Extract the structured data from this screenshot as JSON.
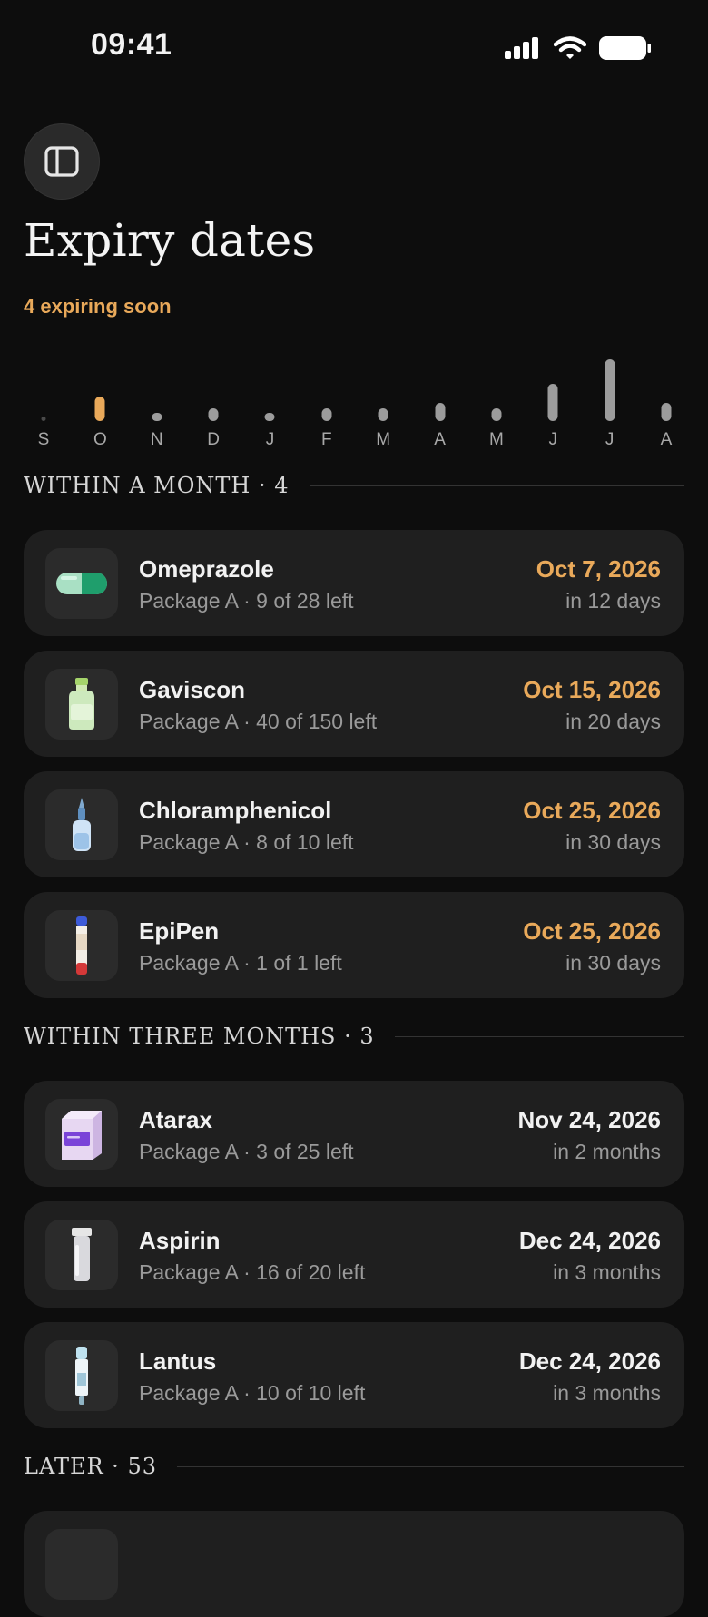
{
  "status_bar": {
    "time": "09:41"
  },
  "header": {
    "title": "Expiry dates",
    "subtitle": "4 expiring soon"
  },
  "timeline": {
    "months": [
      {
        "label": "S",
        "count": 0,
        "highlight": false
      },
      {
        "label": "O",
        "count": 4,
        "highlight": true
      },
      {
        "label": "N",
        "count": 1,
        "highlight": false
      },
      {
        "label": "D",
        "count": 2,
        "highlight": false
      },
      {
        "label": "J",
        "count": 1,
        "highlight": false
      },
      {
        "label": "F",
        "count": 2,
        "highlight": false
      },
      {
        "label": "M",
        "count": 2,
        "highlight": false
      },
      {
        "label": "A",
        "count": 3,
        "highlight": false
      },
      {
        "label": "M",
        "count": 2,
        "highlight": false
      },
      {
        "label": "J",
        "count": 6,
        "highlight": false
      },
      {
        "label": "J",
        "count": 10,
        "highlight": false
      },
      {
        "label": "A",
        "count": 3,
        "highlight": false
      }
    ],
    "colors": {
      "bar": "#9c9c9c",
      "highlight": "#e9a95a",
      "empty": "#4a4a4a"
    }
  },
  "sections": [
    {
      "title": "WITHIN A MONTH · 4",
      "items": [
        {
          "name": "Omeprazole",
          "sub": "Package A · 9 of 28 left",
          "date": "Oct 7, 2026",
          "rel": "in 12 days",
          "soon": true,
          "icon": "capsule-icon"
        },
        {
          "name": "Gaviscon",
          "sub": "Package A · 40 of 150 left",
          "date": "Oct 15, 2026",
          "rel": "in 20 days",
          "soon": true,
          "icon": "bottle-icon"
        },
        {
          "name": "Chloramphenicol",
          "sub": "Package A · 8 of 10 left",
          "date": "Oct 25, 2026",
          "rel": "in 30 days",
          "soon": true,
          "icon": "dropper-icon"
        },
        {
          "name": "EpiPen",
          "sub": "Package A · 1 of 1 left",
          "date": "Oct 25, 2026",
          "rel": "in 30 days",
          "soon": true,
          "icon": "autoinjector-icon"
        }
      ]
    },
    {
      "title": "WITHIN THREE MONTHS · 3",
      "items": [
        {
          "name": "Atarax",
          "sub": "Package A · 3 of 25 left",
          "date": "Nov 24, 2026",
          "rel": "in 2 months",
          "soon": false,
          "icon": "box-icon"
        },
        {
          "name": "Aspirin",
          "sub": "Package A · 16 of 20 left",
          "date": "Dec 24, 2026",
          "rel": "in 3 months",
          "soon": false,
          "icon": "tube-icon"
        },
        {
          "name": "Lantus",
          "sub": "Package A · 10 of 10 left",
          "date": "Dec 24, 2026",
          "rel": "in 3 months",
          "soon": false,
          "icon": "pen-icon"
        }
      ]
    },
    {
      "title": "LATER · 53",
      "items": []
    }
  ]
}
